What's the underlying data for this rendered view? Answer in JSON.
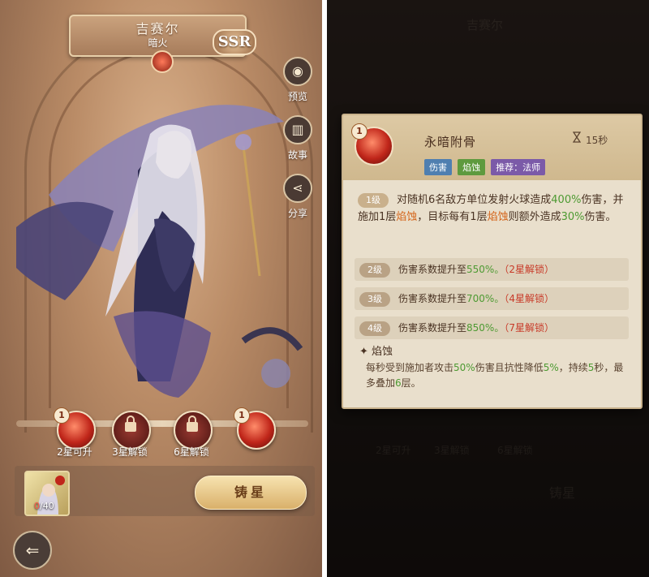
{
  "character": {
    "name": "吉赛尔",
    "faction": "暗火",
    "rarity": "SSR"
  },
  "side_menu": [
    {
      "label": "预览",
      "icon": "preview-icon"
    },
    {
      "label": "故事",
      "icon": "book-icon"
    },
    {
      "label": "分享",
      "icon": "share-icon"
    }
  ],
  "skills": [
    {
      "label": "2星可升",
      "level": "1",
      "state": "upgradable"
    },
    {
      "label": "3星解锁",
      "level": "",
      "state": "locked"
    },
    {
      "label": "6星解锁",
      "level": "",
      "state": "locked"
    },
    {
      "label": "",
      "level": "1",
      "state": "unlocked"
    }
  ],
  "fragments": {
    "current": "0",
    "max": "40",
    "separator": "/"
  },
  "forge_label": "铸星",
  "back_icon": "back-arrow-icon",
  "skill_card": {
    "level_badge": "1",
    "title": "永暗附骨",
    "cooldown": "15秒",
    "tags": [
      "伤害",
      "焰蚀",
      "推荐：法师"
    ],
    "level1": {
      "pill": "1级",
      "text_a": "对随机6名敌方单位发射火球造成",
      "val_a": "400%",
      "text_b": "伤害，并施加1层",
      "kw_1": "焰蚀",
      "text_c": "，目标每有1层",
      "kw_2": "焰蚀",
      "text_d": "则额外造成",
      "val_b": "30%",
      "text_e": "伤害。"
    },
    "upgrades": [
      {
        "pill": "2级",
        "text": "伤害系数提升至",
        "value": "550%。",
        "unlock": "（2星解锁）"
      },
      {
        "pill": "3级",
        "text": "伤害系数提升至",
        "value": "700%。",
        "unlock": "（4星解锁）"
      },
      {
        "pill": "4级",
        "text": "伤害系数提升至",
        "value": "850%。",
        "unlock": "（7星解锁）"
      }
    ],
    "effect": {
      "title": "焰蚀",
      "t1": "每秒受到施加者攻击",
      "v1": "50%",
      "t2": "伤害且抗性降低",
      "v2": "5%",
      "t3": "，持续",
      "v3": "5",
      "t4": "秒，最多叠加",
      "v4": "6",
      "t5": "层。"
    }
  },
  "colors": {
    "positive": "#4d9a32",
    "keyword": "#d4641a",
    "unlock": "#c83a28"
  }
}
